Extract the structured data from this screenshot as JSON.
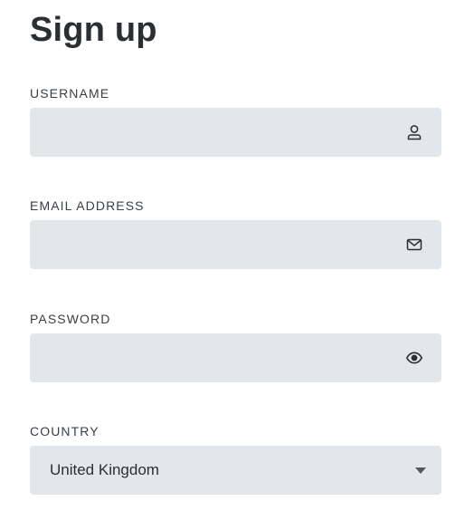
{
  "page": {
    "title": "Sign up"
  },
  "fields": {
    "username": {
      "label": "USERNAME",
      "value": "",
      "icon": "user-icon"
    },
    "email": {
      "label": "EMAIL ADDRESS",
      "value": "",
      "icon": "envelope-icon"
    },
    "password": {
      "label": "PASSWORD",
      "value": "",
      "icon": "eye-icon"
    },
    "country": {
      "label": "COUNTRY",
      "selected": "United Kingdom",
      "icon": "chevron-down-icon"
    }
  },
  "colors": {
    "field_background": "#e3e7ea",
    "text": "#2b2f33",
    "icon": "#2b2f33"
  }
}
